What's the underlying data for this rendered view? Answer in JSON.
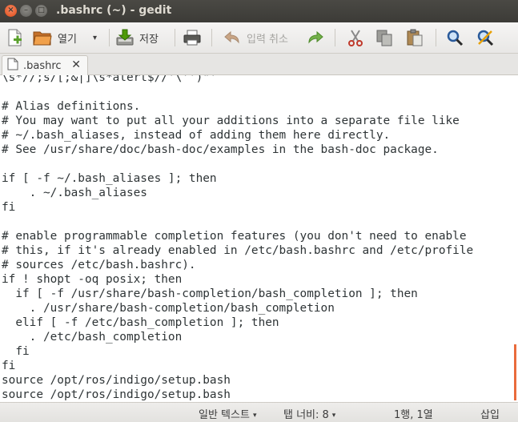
{
  "window": {
    "title": ".bashrc (~) - gedit",
    "close_glyph": "×",
    "minimize_glyph": "–",
    "maximize_glyph": "□"
  },
  "toolbar": {
    "new_icon": "new-document-icon",
    "open_label": "열기",
    "open_dropdown_glyph": "▾",
    "save_label": "저장",
    "print_icon": "printer-icon",
    "undo_label": "입력 취소",
    "redo_icon": "redo-icon",
    "cut_icon": "scissors-icon",
    "copy_icon": "copy-icon",
    "paste_icon": "clipboard-icon",
    "find_icon": "magnifier-icon",
    "replace_icon": "find-replace-icon"
  },
  "tab": {
    "name": ".bashrc",
    "close_glyph": "✕"
  },
  "editor": {
    "lines": [
      "\\s*//;s/[;&|]\\s*alert$//'\\'')\"'",
      "",
      "# Alias definitions.",
      "# You may want to put all your additions into a separate file like",
      "# ~/.bash_aliases, instead of adding them here directly.",
      "# See /usr/share/doc/bash-doc/examples in the bash-doc package.",
      "",
      "if [ -f ~/.bash_aliases ]; then",
      "    . ~/.bash_aliases",
      "fi",
      "",
      "# enable programmable completion features (you don't need to enable",
      "# this, if it's already enabled in /etc/bash.bashrc and /etc/profile",
      "# sources /etc/bash.bashrc).",
      "if ! shopt -oq posix; then",
      "  if [ -f /usr/share/bash-completion/bash_completion ]; then",
      "    . /usr/share/bash-completion/bash_completion",
      "  elif [ -f /etc/bash_completion ]; then",
      "    . /etc/bash_completion",
      "  fi",
      "fi",
      "source /opt/ros/indigo/setup.bash",
      "source /opt/ros/indigo/setup.bash"
    ]
  },
  "statusbar": {
    "language": "일반 텍스트",
    "tab_width": "탭 너비: 8",
    "dropdown_glyph": "▾",
    "position": "1행, 1열",
    "mode": "삽입"
  },
  "colors": {
    "titlebar": "#3c3b37",
    "close_button": "#df4a16",
    "scroll_marker": "#e96b3c"
  }
}
